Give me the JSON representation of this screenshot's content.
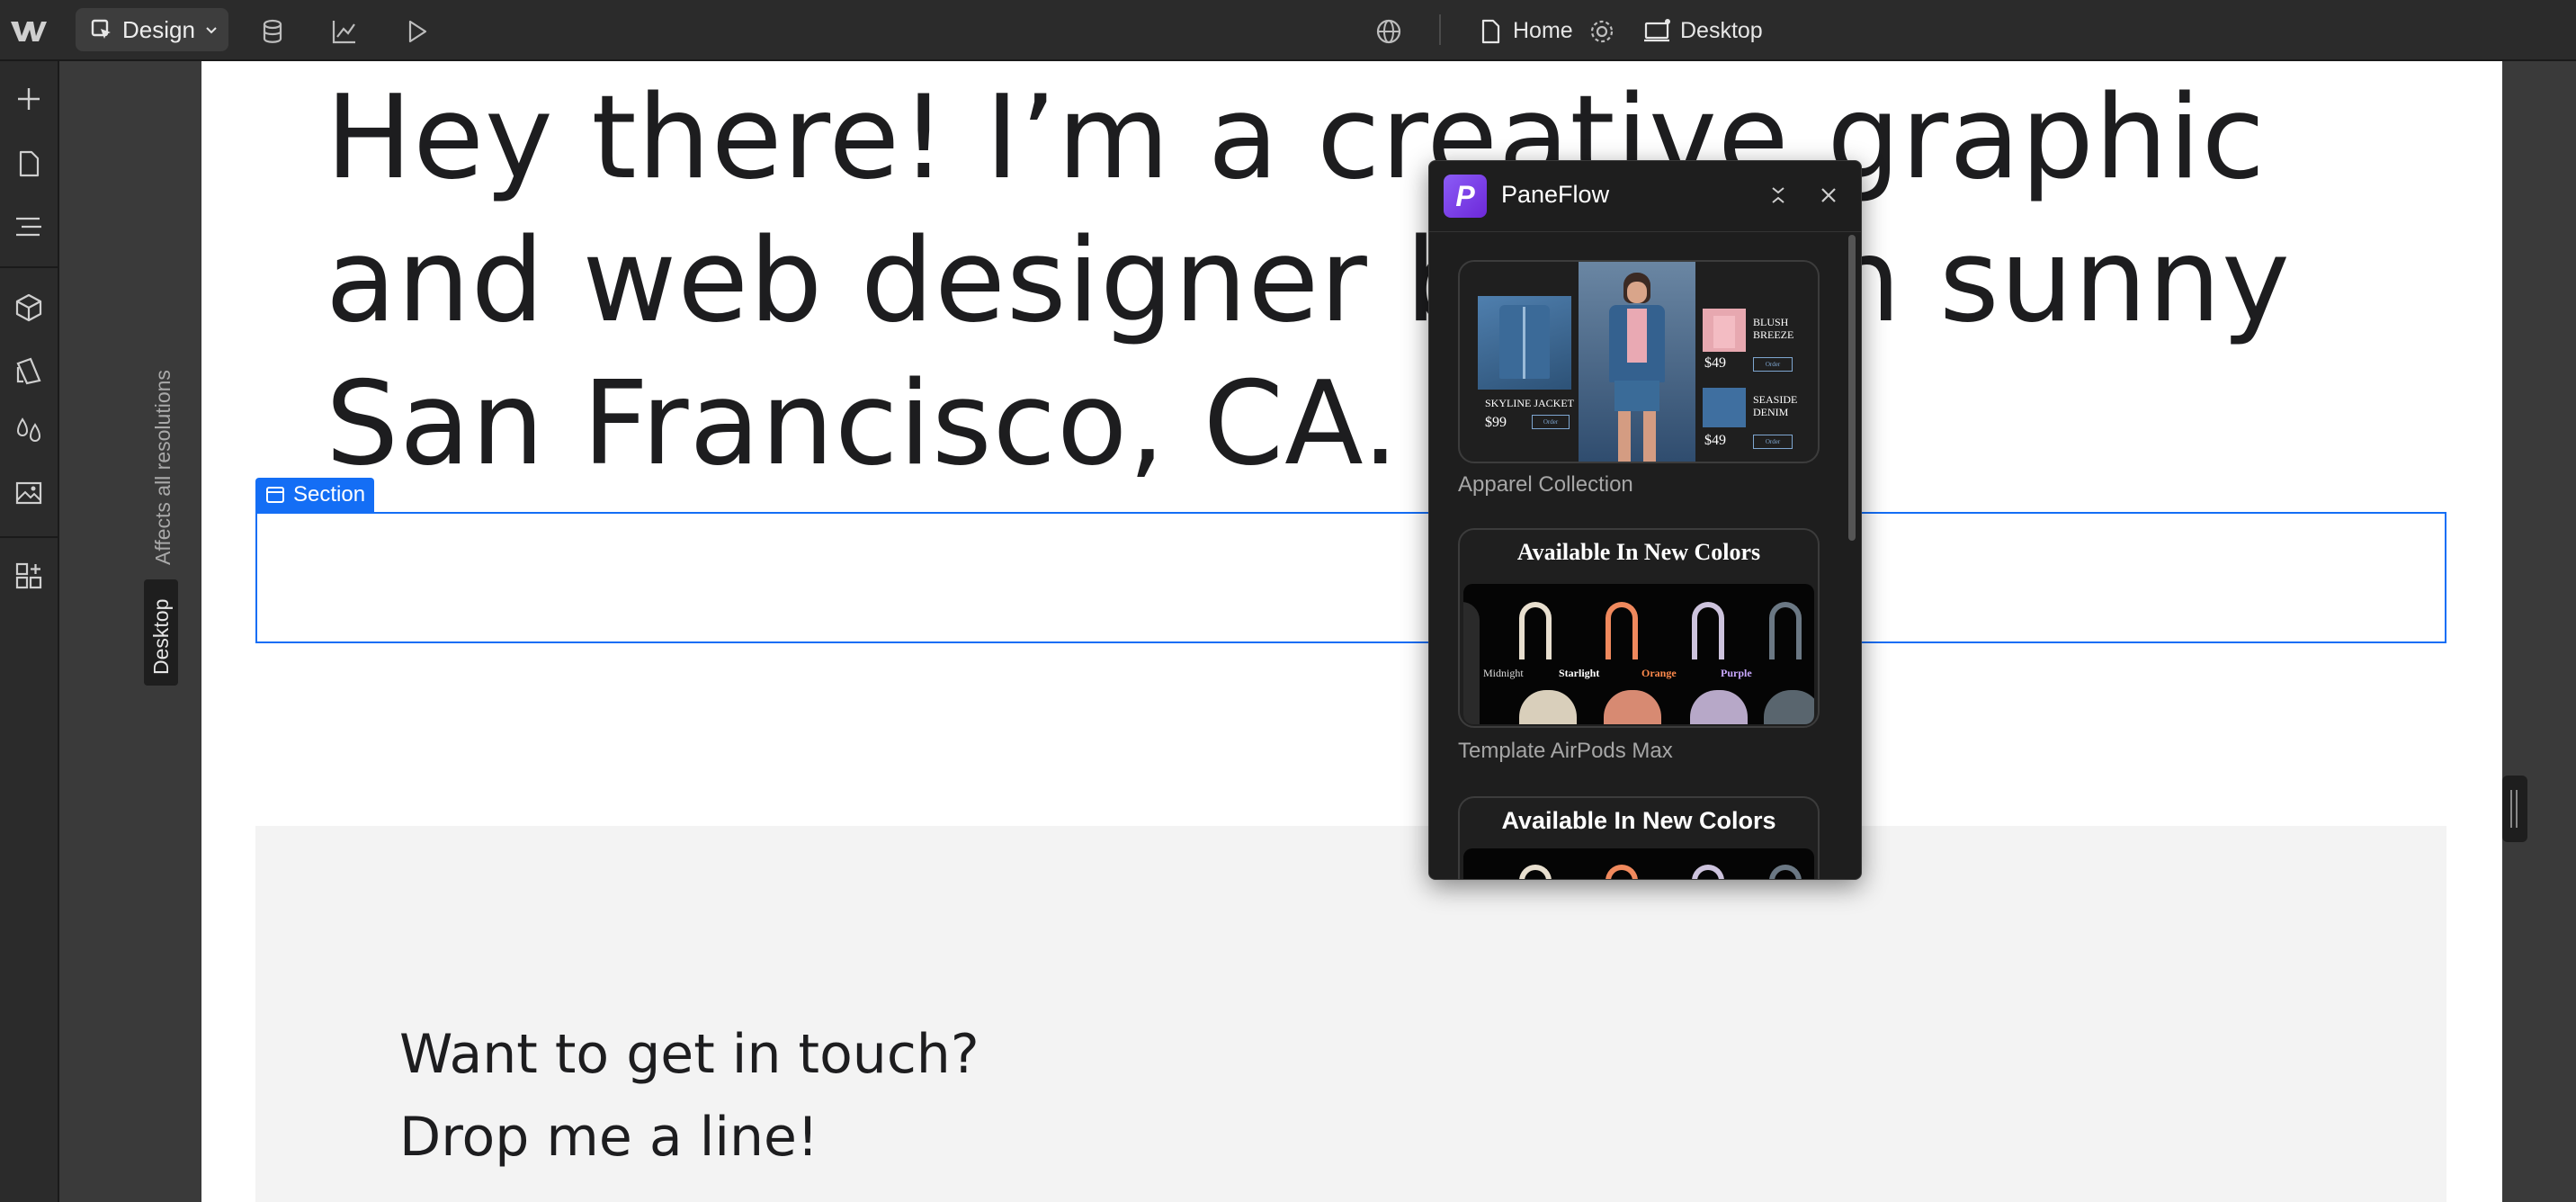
{
  "toolbar": {
    "mode_label": "Design",
    "page_label": "Home",
    "breakpoint_label": "Desktop"
  },
  "canvas": {
    "vertical_hint": "Affects all resolutions",
    "breakpoint_badge": "Desktop",
    "hero_lines": [
      "Hey there! I’m a creative graphic",
      "and web designer based in sunny",
      "San Francisco, CA."
    ],
    "section_tag": "Section",
    "contact_lines": [
      "Want to get in touch?",
      "Drop me a line!"
    ]
  },
  "panel": {
    "app_name": "PaneFlow",
    "templates": [
      {
        "label": "Apparel Collection",
        "items": [
          {
            "name": "SKYLINE JACKET",
            "price": "$99",
            "cta": "Order"
          },
          {
            "name": "BLUSH BREEZE",
            "price": "$49",
            "cta": "Order"
          },
          {
            "name": "SEASIDE DENIM",
            "price": "$49",
            "cta": "Order"
          }
        ]
      },
      {
        "label": "Template AirPods Max",
        "headline": "Available In New Colors",
        "colors": [
          "Midnight",
          "Starlight",
          "Orange",
          "Purple"
        ]
      },
      {
        "label": "",
        "headline": "Available In New Colors"
      }
    ]
  },
  "icons": {
    "top": [
      "webflow-logo-icon",
      "cursor-design-icon",
      "chevron-down-icon",
      "database-icon",
      "analytics-icon",
      "play-icon",
      "globe-icon",
      "page-icon",
      "gear-icon",
      "desktop-breakpoint-icon"
    ],
    "side": [
      "add-icon",
      "pages-icon",
      "navigator-icon",
      "components-icon",
      "styles-icon",
      "variables-icon",
      "assets-icon",
      "apps-icon"
    ]
  },
  "colors": {
    "accent": "#146ef5",
    "panel_brand": "#7c3aed",
    "orange_label": "#ff8a4c",
    "purple_label": "#c9a8ff"
  }
}
